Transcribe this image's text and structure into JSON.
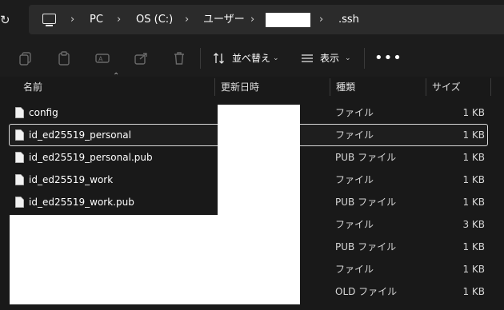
{
  "address": {
    "path": [
      "PC",
      "OS (C:)",
      "ユーザー",
      "",
      ".ssh"
    ],
    "icons": [
      "refresh-icon",
      "computer-icon",
      "chevron-right-icon"
    ]
  },
  "toolbar": {
    "sort_label": "並べ替え",
    "view_label": "表示",
    "more_label": "•••",
    "icons": [
      "copy-icon",
      "paste-icon",
      "rename-icon",
      "share-icon",
      "delete-icon",
      "sort-icon",
      "view-icon"
    ]
  },
  "columns": {
    "name": "名前",
    "modified": "更新日時",
    "type": "種類",
    "size": "サイズ"
  },
  "files": [
    {
      "name": "config",
      "type": "ファイル",
      "size": "1 KB",
      "selected": false
    },
    {
      "name": "id_ed25519_personal",
      "type": "ファイル",
      "size": "1 KB",
      "selected": true
    },
    {
      "name": "id_ed25519_personal.pub",
      "type": "PUB ファイル",
      "size": "1 KB",
      "selected": false
    },
    {
      "name": "id_ed25519_work",
      "type": "ファイル",
      "size": "1 KB",
      "selected": false
    },
    {
      "name": "id_ed25519_work.pub",
      "type": "PUB ファイル",
      "size": "1 KB",
      "selected": false
    },
    {
      "name": "",
      "type": "ファイル",
      "size": "3 KB",
      "selected": false
    },
    {
      "name": "",
      "type": "PUB ファイル",
      "size": "1 KB",
      "selected": false
    },
    {
      "name": "",
      "type": "ファイル",
      "size": "1 KB",
      "selected": false
    },
    {
      "name": "",
      "type": "OLD ファイル",
      "size": "1 KB",
      "selected": false
    }
  ]
}
